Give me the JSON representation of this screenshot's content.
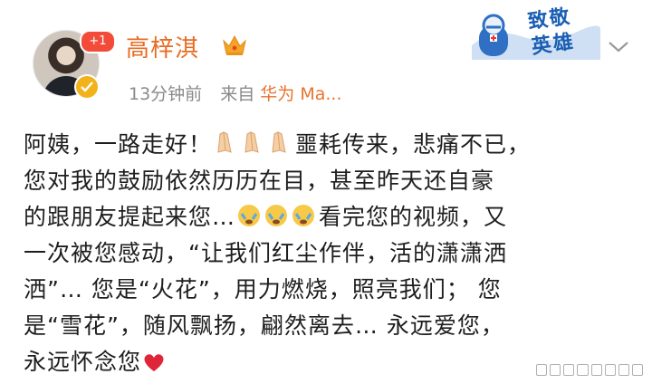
{
  "header": {
    "username": "高梓淇",
    "unread_count": "+1",
    "time": "13分钟前",
    "source_prefix": "来自",
    "source_name": "华为 Ma...",
    "banner_line1": "致敬",
    "banner_line2": "英雄"
  },
  "post": {
    "lines": [
      {
        "before": "阿姨，一路走好！",
        "after": "噩耗传来，悲痛不已，",
        "emoji": "pray"
      },
      {
        "before": "您对我的鼓励依然历历在目，甚至昨天还自豪",
        "after": "",
        "emoji": ""
      },
      {
        "before": "的跟朋友提起来您…",
        "after": "看完您的视频，又",
        "emoji": "cry"
      },
      {
        "before": "一次被您感动，“让我们红尘作伴，活的潇潇洒",
        "after": "",
        "emoji": ""
      },
      {
        "before": "洒”… 您是“火花”，用力燃烧，照亮我们； 您",
        "after": "",
        "emoji": ""
      },
      {
        "before": "是“雪花”，随风飘扬，翩然离去…  永远爱您，",
        "after": "",
        "emoji": ""
      },
      {
        "before": "永远怀念您",
        "after": "",
        "emoji": "heart"
      }
    ]
  },
  "icons": {
    "crown": "crown-icon",
    "verified": "verified-icon",
    "chevron": "chevron-down-icon",
    "pray": "folded-hands-icon",
    "cry": "crying-face-icon",
    "heart": "red-heart-icon"
  },
  "colors": {
    "username": "#e86b22",
    "source": "#e8732c",
    "meta": "#8a8a8a",
    "badge": "#f24b3a",
    "banner": "#1b5fb3"
  }
}
